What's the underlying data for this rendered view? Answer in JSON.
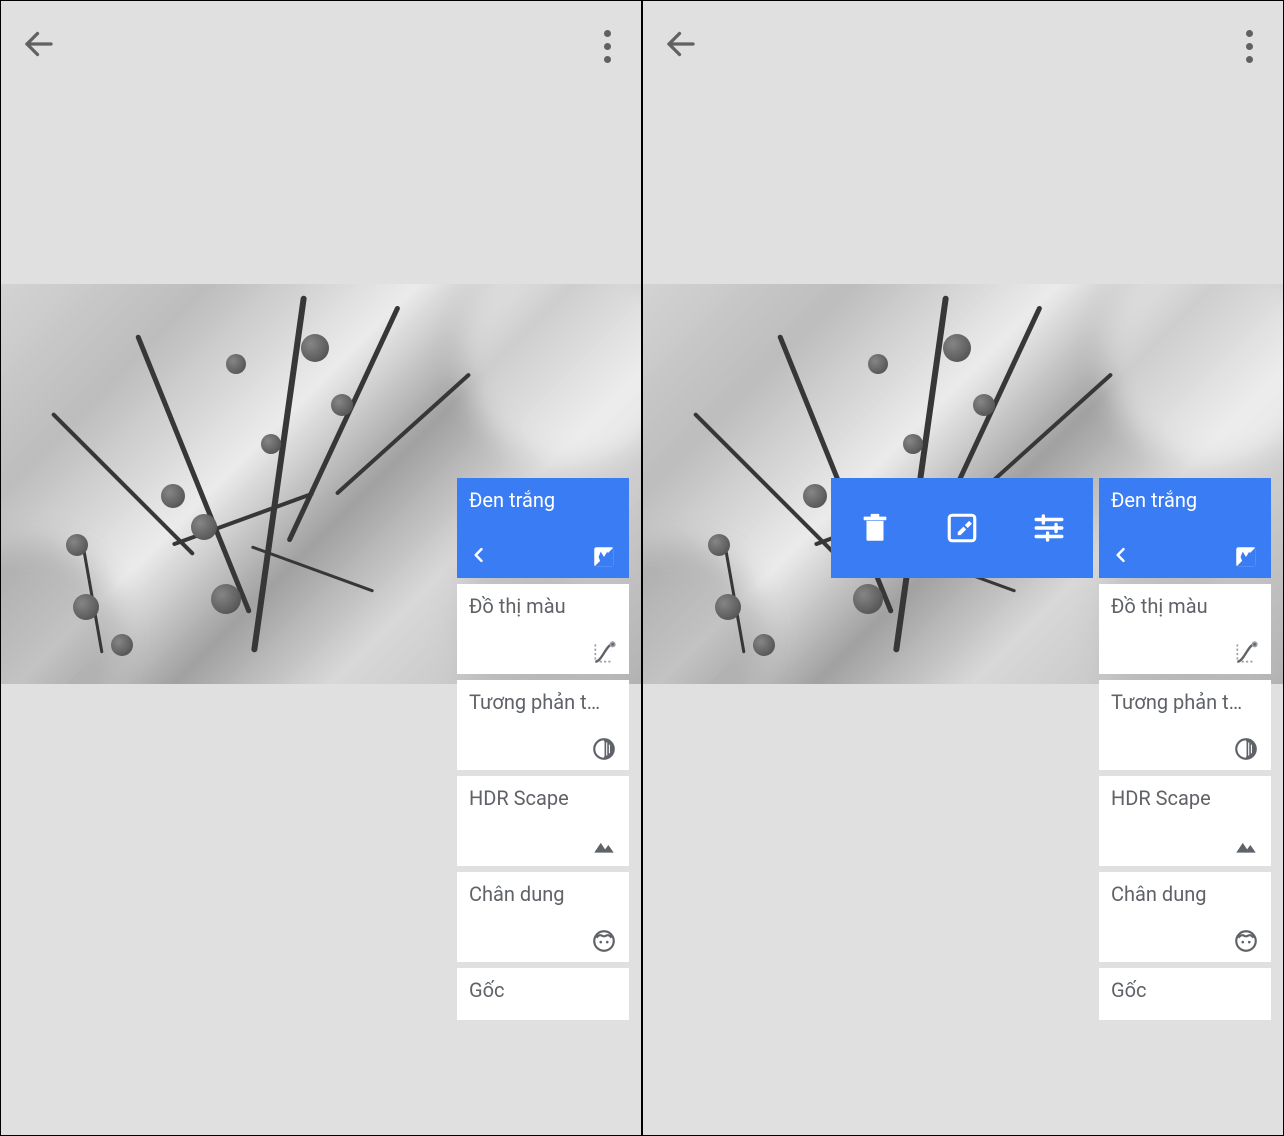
{
  "colors": {
    "accent": "#3a7cf4",
    "muted_text": "#5f6368",
    "panel_bg": "#e0e0e0"
  },
  "panels": [
    {
      "has_action_bar": false
    },
    {
      "has_action_bar": true
    }
  ],
  "action_bar": {
    "delete_icon": "trash-icon",
    "edit_icon": "brush-square-icon",
    "tune_icon": "sliders-icon"
  },
  "stack": {
    "selected_index": 0,
    "items": [
      {
        "label": "Đen trắng",
        "icon": "bw-contrast-icon",
        "selected": true,
        "show_back": true
      },
      {
        "label": "Đồ thị màu",
        "icon": "curves-icon"
      },
      {
        "label": "Tương phản t…",
        "icon": "tonal-contrast-icon"
      },
      {
        "label": "HDR Scape",
        "icon": "landscape-icon"
      },
      {
        "label": "Chân dung",
        "icon": "face-icon"
      },
      {
        "label": "Gốc",
        "icon": null,
        "is_root": true
      }
    ]
  }
}
